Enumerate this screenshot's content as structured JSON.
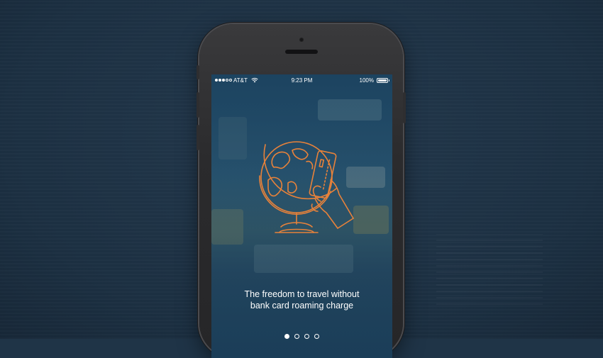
{
  "status_bar": {
    "carrier": "AT&T",
    "time": "9:23 PM",
    "battery": "100%",
    "signal_bars": 3,
    "signal_max": 5,
    "battery_level": 1.0
  },
  "onboarding": {
    "headline": "The freedom to travel without\nbank card roaming charge",
    "illustration_icon": "globe-with-card-in-hand-icon",
    "pages": 4,
    "current_page": 1
  },
  "colors": {
    "background": "#1f3447",
    "accent_orange": "#e8823a",
    "text": "#ffffff"
  }
}
